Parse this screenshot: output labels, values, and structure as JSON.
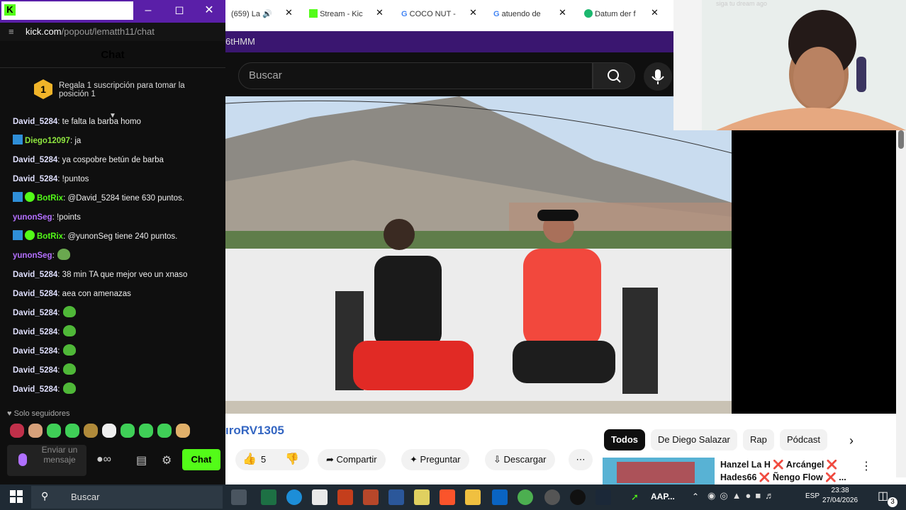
{
  "popup": {
    "url_domain": "kick.com",
    "url_path": "/popout/lematth11/chat",
    "chat_title": "Chat",
    "pinned_badge": "1",
    "pinned_text": "Regala 1 suscripción para tomar la posición 1",
    "messages": [
      {
        "user": "David_5284",
        "text": ": te falta la barba homo",
        "color": "#e0e0ff"
      },
      {
        "user": "Diego12097",
        "text": ": ja",
        "color": "#8fe63f",
        "badge": true
      },
      {
        "user": "David_5284",
        "text": ": ya cospobre betún de barba",
        "color": "#e0e0ff"
      },
      {
        "user": "David_5284",
        "text": ": !puntos",
        "color": "#e0e0ff"
      },
      {
        "user": "BotRix",
        "text": ": @David_5284 tiene 630 puntos.",
        "color": "#53fc18",
        "badge": true,
        "verified": true
      },
      {
        "user": "yunonSeg",
        "text": ": !points",
        "color": "#b470ff"
      },
      {
        "user": "BotRix",
        "text": ": @yunonSeg tiene 240 puntos.",
        "color": "#53fc18",
        "badge": true,
        "verified": true
      },
      {
        "user": "yunonSeg",
        "text": ":",
        "color": "#b470ff",
        "emote": "frog-emote"
      },
      {
        "user": "David_5284",
        "text": ": 38 min TA que mejor veo un xnaso",
        "color": "#e0e0ff"
      },
      {
        "user": "David_5284",
        "text": ": aea con amenazas",
        "color": "#e0e0ff"
      },
      {
        "user": "David_5284",
        "text": ":",
        "color": "#e0e0ff",
        "emote": "pepe-emote"
      },
      {
        "user": "David_5284",
        "text": ":",
        "color": "#e0e0ff",
        "emote": "pepe-emote"
      },
      {
        "user": "David_5284",
        "text": ":",
        "color": "#e0e0ff",
        "emote": "pepe-emote"
      },
      {
        "user": "David_5284",
        "text": ":",
        "color": "#e0e0ff",
        "emote": "pepe-emote"
      },
      {
        "user": "David_5284",
        "text": ":",
        "color": "#e0e0ff",
        "emote": "pepe-emote"
      }
    ],
    "followers_only": "Solo seguidores",
    "input_placeholder": "Enviar un mensaje",
    "chat_button": "Chat"
  },
  "tabs": [
    {
      "label": "(659) La",
      "icon": "youtube-icon"
    },
    {
      "label": "Stream - Kic",
      "icon": "kick-icon"
    },
    {
      "label": "COCO NUT -",
      "icon": "google-icon"
    },
    {
      "label": "atuendo de",
      "icon": "google-icon"
    },
    {
      "label": "Datum der f",
      "icon": "datum-icon"
    }
  ],
  "purple_bar_text": "6tHMM",
  "youtube": {
    "search_placeholder": "Buscar",
    "channel": "ıroRV1305",
    "likes": "5",
    "share": "Compartir",
    "ask": "Preguntar",
    "download": "Descargar",
    "chips": [
      "Todos",
      "De Diego Salazar",
      "Rap",
      "Pódcast"
    ],
    "rec_title_line1": "Hanzel La H ❌ Arcángel ❌",
    "rec_title_line2": "Hades66 ❌ Ñengo Flow ❌ ..."
  },
  "webcam_text": "siga tu dream ago",
  "taskbar": {
    "search": "Buscar",
    "app_label": "AAP...",
    "lang": "ESP",
    "time": "23:38",
    "date": "27/04/2026",
    "notifications": "3"
  },
  "colors": {
    "kick_green": "#53fc18",
    "twitch_purple": "#3a1670"
  }
}
